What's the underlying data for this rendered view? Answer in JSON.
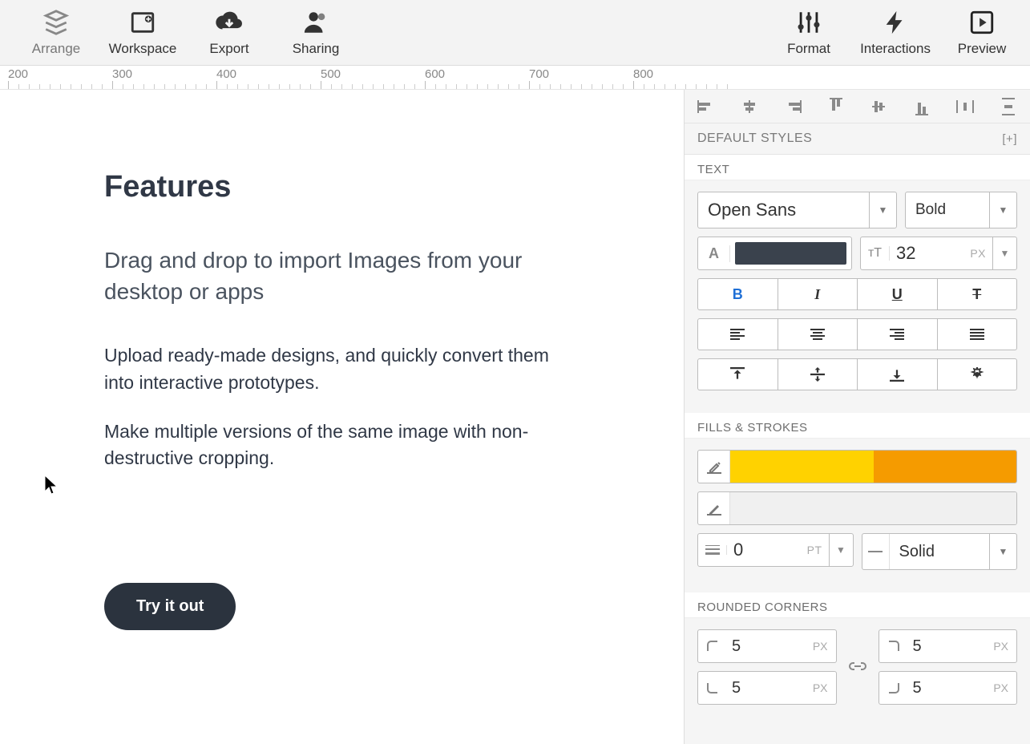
{
  "toolbar": {
    "left": [
      "Arrange",
      "Workspace",
      "Export",
      "Sharing"
    ],
    "right": [
      "Format",
      "Interactions",
      "Preview"
    ]
  },
  "ruler": {
    "start": 200,
    "step": 100,
    "count": 7
  },
  "canvas": {
    "title": "Features",
    "subtitle": "Drag and drop to import Images from your desktop or apps",
    "body1": "Upload ready-made designs, and quickly convert them into interactive prototypes.",
    "body2": "Make multiple versions of the same image with non-destructive cropping.",
    "cta": "Try it out"
  },
  "panel": {
    "defaults_label": "DEFAULT STYLES",
    "defaults_add": "[+]",
    "text_label": "TEXT",
    "font_family": "Open Sans",
    "font_weight": "Bold",
    "font_color_label": "A",
    "font_color": "#3a424d",
    "font_size": "32",
    "font_unit": "PX",
    "fills_label": "FILLS & STROKES",
    "fill_color1": "#ffd200",
    "fill_color2": "#f59b00",
    "stroke_width": "0",
    "stroke_unit": "PT",
    "stroke_style": "Solid",
    "corners_label": "ROUNDED CORNERS",
    "corner_tl": "5",
    "corner_tr": "5",
    "corner_bl": "5",
    "corner_br": "5",
    "corner_unit": "PX"
  }
}
